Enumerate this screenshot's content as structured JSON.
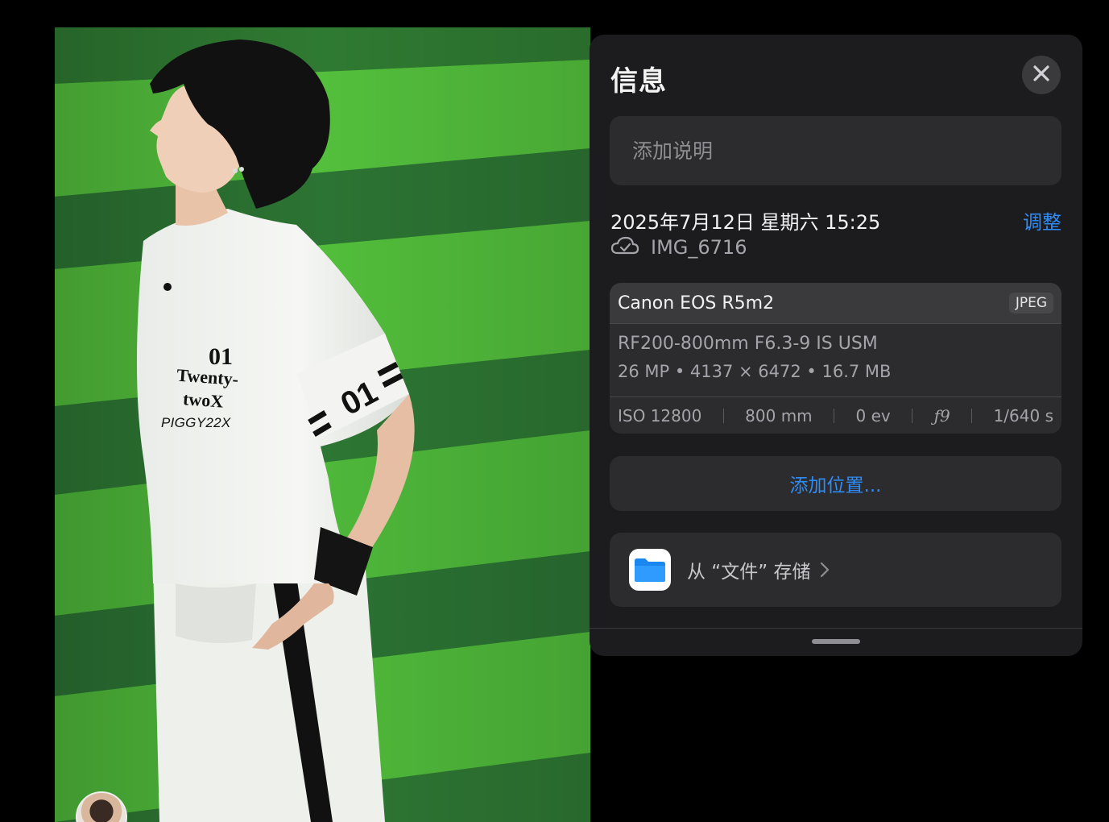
{
  "panel": {
    "title": "信息",
    "close_icon": "xmark-icon",
    "caption_placeholder": "添加说明",
    "datetime": "2025年7月12日 星期六 15:25",
    "adjust_label": "调整",
    "cloud_icon": "cloud-check-icon",
    "filename": "IMG_6716"
  },
  "camera": {
    "model": "Canon EOS R5m2",
    "format": "JPEG",
    "lens": "RF200-800mm F6.3-9 IS USM",
    "specs": "26 MP • 4137 × 6472 • 16.7 MB",
    "exif": {
      "iso": "ISO 12800",
      "focal_length": "800 mm",
      "exposure": "0 ev",
      "aperture": "ƒ9",
      "shutter": "1/640 s"
    }
  },
  "location": {
    "label": "添加位置..."
  },
  "files": {
    "icon": "folder-icon",
    "label": "从 “文件” 存储",
    "chevron_icon": "chevron-right-icon"
  },
  "photo": {
    "shirt_number": "01",
    "shirt_text_line1": "Twenty-",
    "shirt_text_line2": "twoX",
    "sleeve_number": "01",
    "watermark": "PIGGY22X"
  },
  "colors": {
    "background": "#000000",
    "panel": "#1c1c1e",
    "card": "#2c2c2e",
    "accent": "#2f8cf6",
    "turf_light": "#4bb53a",
    "turf_dark": "#2e7d33"
  }
}
